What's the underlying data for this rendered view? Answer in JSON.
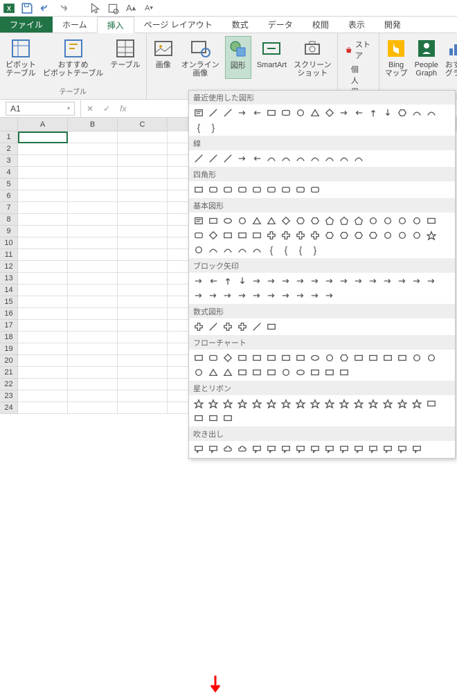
{
  "title_bar": {
    "app_name": "Excel"
  },
  "tabs": {
    "file": "ファイル",
    "home": "ホーム",
    "insert": "挿入",
    "page_layout": "ページ レイアウト",
    "formulas": "数式",
    "data": "データ",
    "review": "校閲",
    "view": "表示",
    "developer": "開発"
  },
  "ribbon": {
    "tables": {
      "pivot_table": "ピボット\nテーブル",
      "recommended_pivot": "おすすめ\nピボットテーブル",
      "table": "テーブル",
      "group_label": "テーブル"
    },
    "illustrations": {
      "pictures": "画像",
      "online_pictures": "オンライン\n画像",
      "shapes": "図形",
      "smartart": "SmartArt",
      "screenshot": "スクリーン\nショット"
    },
    "apps": {
      "store": "ストア",
      "my_apps": "個人用アプリ"
    },
    "other": {
      "bing_maps": "Bing\nマップ",
      "people_graph": "People\nGraph",
      "recommended_charts": "おすす\nグラフ"
    }
  },
  "name_box": {
    "value": "A1"
  },
  "formula_bar": {
    "fx": "fx"
  },
  "columns": [
    "A",
    "B",
    "C"
  ],
  "shapes_menu": {
    "recent": "最近使用した図形",
    "lines": "線",
    "rectangles": "四角形",
    "basic": "基本図形",
    "block_arrows": "ブロック矢印",
    "equation": "数式図形",
    "flowchart": "フローチャート",
    "stars": "星とリボン",
    "callouts": "吹き出し"
  }
}
